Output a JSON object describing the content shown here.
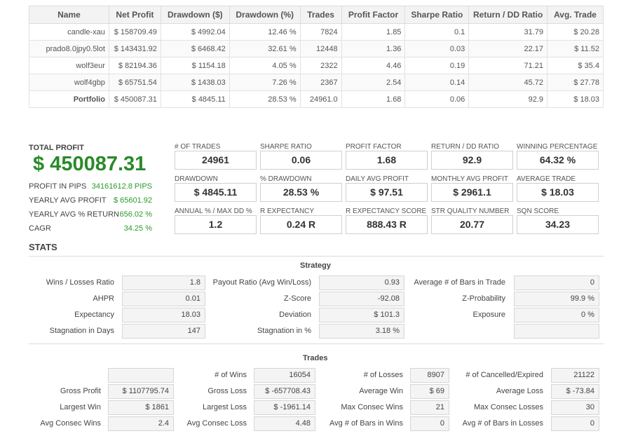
{
  "portfolio_table": {
    "headers": [
      "Name",
      "Net Profit",
      "Drawdown ($)",
      "Drawdown (%)",
      "Trades",
      "Profit Factor",
      "Sharpe Ratio",
      "Return / DD Ratio",
      "Avg. Trade"
    ],
    "rows": [
      [
        "candle-xau",
        "$ 158709.49",
        "$ 4992.04",
        "12.46 %",
        "7824",
        "1.85",
        "0.1",
        "31.79",
        "$ 20.28"
      ],
      [
        "prado8.0jpy0.5lot",
        "$ 143431.92",
        "$ 6468.42",
        "32.61 %",
        "12448",
        "1.36",
        "0.03",
        "22.17",
        "$ 11.52"
      ],
      [
        "wolf3eur",
        "$ 82194.36",
        "$ 1154.18",
        "4.05 %",
        "2322",
        "4.46",
        "0.19",
        "71.21",
        "$ 35.4"
      ],
      [
        "wolf4gbp",
        "$ 65751.54",
        "$ 1438.03",
        "7.26 %",
        "2367",
        "2.54",
        "0.14",
        "45.72",
        "$ 27.78"
      ],
      [
        "Portfolio",
        "$ 450087.31",
        "$ 4845.11",
        "28.53 %",
        "24961.0",
        "1.68",
        "0.06",
        "92.9",
        "$ 18.03"
      ]
    ]
  },
  "summary": {
    "total_profit_label": "TOTAL PROFIT",
    "total_profit_value": "$ 450087.31",
    "rows": [
      {
        "label": "PROFIT IN PIPS",
        "value": "34161612.8 PIPS"
      },
      {
        "label": "YEARLY AVG PROFIT",
        "value": "$ 65601.92"
      },
      {
        "label": "YEARLY AVG % RETURN",
        "value": "656.02 %"
      },
      {
        "label": "CAGR",
        "value": "34.25 %"
      }
    ]
  },
  "kpis": [
    {
      "label": "# OF TRADES",
      "value": "24961"
    },
    {
      "label": "SHARPE RATIO",
      "value": "0.06"
    },
    {
      "label": "PROFIT FACTOR",
      "value": "1.68"
    },
    {
      "label": "RETURN / DD RATIO",
      "value": "92.9"
    },
    {
      "label": "WINNING PERCENTAGE",
      "value": "64.32 %"
    },
    {
      "label": "DRAWDOWN",
      "value": "$ 4845.11"
    },
    {
      "label": "% DRAWDOWN",
      "value": "28.53 %"
    },
    {
      "label": "DAILY AVG PROFIT",
      "value": "$ 97.51"
    },
    {
      "label": "MONTHLY AVG PROFIT",
      "value": "$ 2961.1"
    },
    {
      "label": "AVERAGE TRADE",
      "value": "$ 18.03"
    },
    {
      "label": "ANNUAL % / MAX DD %",
      "value": "1.2"
    },
    {
      "label": "R EXPECTANCY",
      "value": "0.24 R"
    },
    {
      "label": "R EXPECTANCY SCORE",
      "value": "888.43 R"
    },
    {
      "label": "STR QUALITY NUMBER",
      "value": "20.77"
    },
    {
      "label": "SQN SCORE",
      "value": "34.23"
    }
  ],
  "stats_title": "STATS",
  "strategy": {
    "title": "Strategy",
    "rows": [
      [
        {
          "label": "Wins / Losses Ratio",
          "value": "1.8"
        },
        {
          "label": "Payout Ratio (Avg Win/Loss)",
          "value": "0.93"
        },
        {
          "label": "Average # of Bars in Trade",
          "value": "0"
        }
      ],
      [
        {
          "label": "AHPR",
          "value": "0.01"
        },
        {
          "label": "Z-Score",
          "value": "-92.08"
        },
        {
          "label": "Z-Probability",
          "value": "99.9 %"
        }
      ],
      [
        {
          "label": "Expectancy",
          "value": "18.03"
        },
        {
          "label": "Deviation",
          "value": "$ 101.3"
        },
        {
          "label": "Exposure",
          "value": "0 %"
        }
      ],
      [
        {
          "label": "Stagnation in Days",
          "value": "147"
        },
        {
          "label": "Stagnation in %",
          "value": "3.18 %"
        },
        {
          "label": "",
          "value": ""
        }
      ]
    ]
  },
  "trades": {
    "title": "Trades",
    "rows": [
      [
        {
          "label": "",
          "value": ""
        },
        {
          "label": "# of Wins",
          "value": "16054"
        },
        {
          "label": "# of Losses",
          "value": "8907"
        },
        {
          "label": "# of Cancelled/Expired",
          "value": "21122"
        }
      ],
      [
        {
          "label": "Gross Profit",
          "value": "$ 1107795.74"
        },
        {
          "label": "Gross Loss",
          "value": "$ -657708.43"
        },
        {
          "label": "Average Win",
          "value": "$ 69"
        },
        {
          "label": "Average Loss",
          "value": "$ -73.84"
        }
      ],
      [
        {
          "label": "Largest Win",
          "value": "$ 1861"
        },
        {
          "label": "Largest Loss",
          "value": "$ -1961.14"
        },
        {
          "label": "Max Consec Wins",
          "value": "21"
        },
        {
          "label": "Max Consec Losses",
          "value": "30"
        }
      ],
      [
        {
          "label": "Avg Consec Wins",
          "value": "2.4"
        },
        {
          "label": "Avg Consec Loss",
          "value": "4.48"
        },
        {
          "label": "Avg # of Bars in Wins",
          "value": "0"
        },
        {
          "label": "Avg # of Bars in Losses",
          "value": "0"
        }
      ]
    ]
  }
}
